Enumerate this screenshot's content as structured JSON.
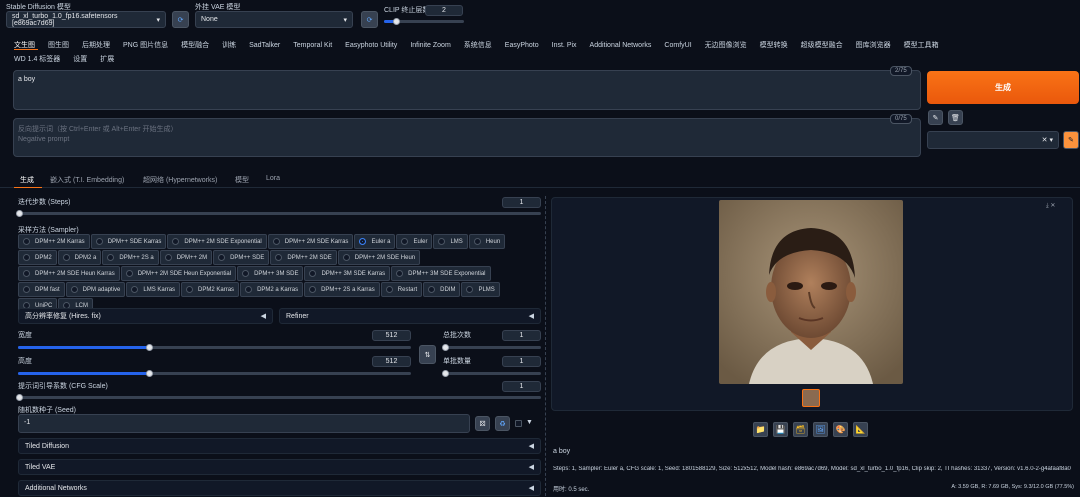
{
  "top": {
    "checkpoint_label": "Stable Diffusion 模型",
    "checkpoint_value": "sd_xl_turbo_1.0_fp16.safetensors [e869ac7d69]",
    "vae_label": "外挂 VAE 模型",
    "vae_value": "None",
    "clip_label": "CLIP 终止层数",
    "clip_value": "2"
  },
  "main_tabs": [
    "文生图",
    "图生图",
    "后期处理",
    "PNG 图片信息",
    "模型融合",
    "训练",
    "SadTalker",
    "Temporal Kit",
    "Easyphoto Utility",
    "Infinite Zoom",
    "系统信息",
    "EasyPhoto",
    "Inst. Pix",
    "Additional Networks",
    "ComfyUI",
    "无边图像浏览",
    "模型转换",
    "超级模型融合",
    "图库浏览器",
    "模型工具箱"
  ],
  "main_tabs_row2": [
    "WD 1.4 标签器",
    "设置",
    "扩展"
  ],
  "prompt": {
    "positive_value": "a boy",
    "positive_counter": "2/75",
    "negative_placeholder": "反向提示词（按 Ctrl+Enter 或 Alt+Enter 开始生成）",
    "negative_placeholder2": "Negative prompt",
    "negative_counter": "0/75"
  },
  "generate_label": "生成",
  "sub_tabs": [
    "生成",
    "嵌入式 (T.I. Embedding)",
    "超网络 (Hypernetworks)",
    "模型",
    "Lora"
  ],
  "steps": {
    "label": "迭代步数 (Steps)",
    "value": "1",
    "fraction": 0.0
  },
  "sampler": {
    "label": "采样方法 (Sampler)",
    "options": [
      "DPM++ 2M Karras",
      "DPM++ SDE Karras",
      "DPM++ 2M SDE Exponential",
      "DPM++ 2M SDE Karras",
      "Euler a",
      "Euler",
      "LMS",
      "Heun",
      "DPM2",
      "DPM2 a",
      "DPM++ 2S a",
      "DPM++ 2M",
      "DPM++ SDE",
      "DPM++ 2M SDE",
      "DPM++ 2M SDE Heun",
      "DPM++ 2M SDE Heun Karras",
      "DPM++ 2M SDE Heun Exponential",
      "DPM++ 3M SDE",
      "DPM++ 3M SDE Karras",
      "DPM++ 3M SDE Exponential",
      "DPM fast",
      "DPM adaptive",
      "LMS Karras",
      "DPM2 Karras",
      "DPM2 a Karras",
      "DPM++ 2S a Karras",
      "Restart",
      "DDIM",
      "PLMS",
      "UniPC",
      "LCM"
    ],
    "selected": "Euler a"
  },
  "hires_label": "高分辨率修复 (Hires. fix)",
  "refiner_label": "Refiner",
  "width": {
    "label": "宽度",
    "value": "512",
    "fraction": 0.333
  },
  "height": {
    "label": "高度",
    "value": "512",
    "fraction": 0.333
  },
  "batch_count": {
    "label": "总批次数",
    "value": "1",
    "fraction": 0.0
  },
  "batch_size": {
    "label": "单批数量",
    "value": "1",
    "fraction": 0.0
  },
  "cfg": {
    "label": "提示词引导系数 (CFG Scale)",
    "value": "1",
    "fraction": 0.0
  },
  "seed": {
    "label": "随机数种子 (Seed)",
    "value": "-1"
  },
  "accordions": [
    "Tiled Diffusion",
    "Tiled VAE",
    "Additional Networks"
  ],
  "output": {
    "caption": "a boy",
    "params": "Steps: 1, Sampler: Euler a, CFG scale: 1, Seed: 1801588129, Size: 512x512, Model hash: e869ac7d69, Model: sd_xl_turbo_1.0_fp16, Clip skip: 2, TI hashes: 31337, Version: v1.6.0-2-g4afaaf8a0",
    "time": "用时: 0.5 sec.",
    "mem": "A: 3.59 GB, R: 7.69 GB, Sys: 9.3/12.0 GB (77.5%)"
  },
  "colors": {
    "accent": "#f97316",
    "bg": "#0b0f19",
    "selected": "#2563eb"
  }
}
